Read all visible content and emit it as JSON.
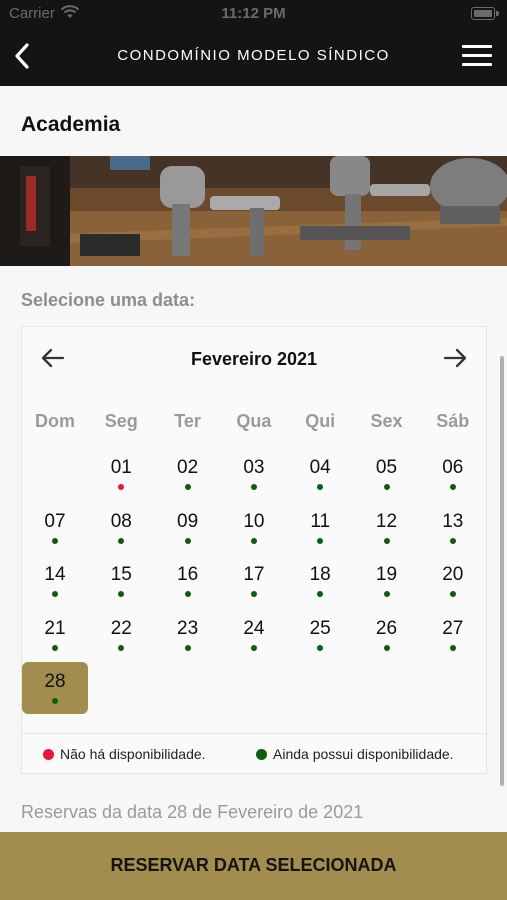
{
  "status_bar": {
    "carrier": "Carrier",
    "time": "11:12 PM"
  },
  "navbar": {
    "title": "CONDOMÍNIO MODELO SÍNDICO",
    "back_icon": "chevron-left-icon",
    "menu_icon": "hamburger-menu-icon"
  },
  "page": {
    "title": "Academia",
    "date_prompt": "Selecione uma data:"
  },
  "calendar": {
    "month_label": "Fevereiro 2021",
    "weekdays": [
      "Dom",
      "Seg",
      "Ter",
      "Qua",
      "Qui",
      "Sex",
      "Sáb"
    ],
    "selected_day": "28",
    "days": [
      {
        "n": "01",
        "status": "unavailable"
      },
      {
        "n": "02",
        "status": "available"
      },
      {
        "n": "03",
        "status": "available"
      },
      {
        "n": "04",
        "status": "available"
      },
      {
        "n": "05",
        "status": "available"
      },
      {
        "n": "06",
        "status": "available"
      },
      {
        "n": "07",
        "status": "available"
      },
      {
        "n": "08",
        "status": "available"
      },
      {
        "n": "09",
        "status": "available"
      },
      {
        "n": "10",
        "status": "available"
      },
      {
        "n": "11",
        "status": "available"
      },
      {
        "n": "12",
        "status": "available"
      },
      {
        "n": "13",
        "status": "available"
      },
      {
        "n": "14",
        "status": "available"
      },
      {
        "n": "15",
        "status": "available"
      },
      {
        "n": "16",
        "status": "available"
      },
      {
        "n": "17",
        "status": "available"
      },
      {
        "n": "18",
        "status": "available"
      },
      {
        "n": "19",
        "status": "available"
      },
      {
        "n": "20",
        "status": "available"
      },
      {
        "n": "21",
        "status": "available"
      },
      {
        "n": "22",
        "status": "available"
      },
      {
        "n": "23",
        "status": "available"
      },
      {
        "n": "24",
        "status": "available"
      },
      {
        "n": "25",
        "status": "available"
      },
      {
        "n": "26",
        "status": "available"
      },
      {
        "n": "27",
        "status": "available"
      },
      {
        "n": "28",
        "status": "available"
      }
    ],
    "legend": {
      "unavailable": "Não há disponibilidade.",
      "available": "Ainda possui disponibilidade."
    }
  },
  "reservas_label": "Reservas da data 28 de Fevereiro de 2021",
  "reserve_button": "RESERVAR DATA SELECIONADA",
  "colors": {
    "available": "#0e5b12",
    "unavailable": "#e8173a",
    "accent": "#a38d4e",
    "header": "#141414"
  }
}
